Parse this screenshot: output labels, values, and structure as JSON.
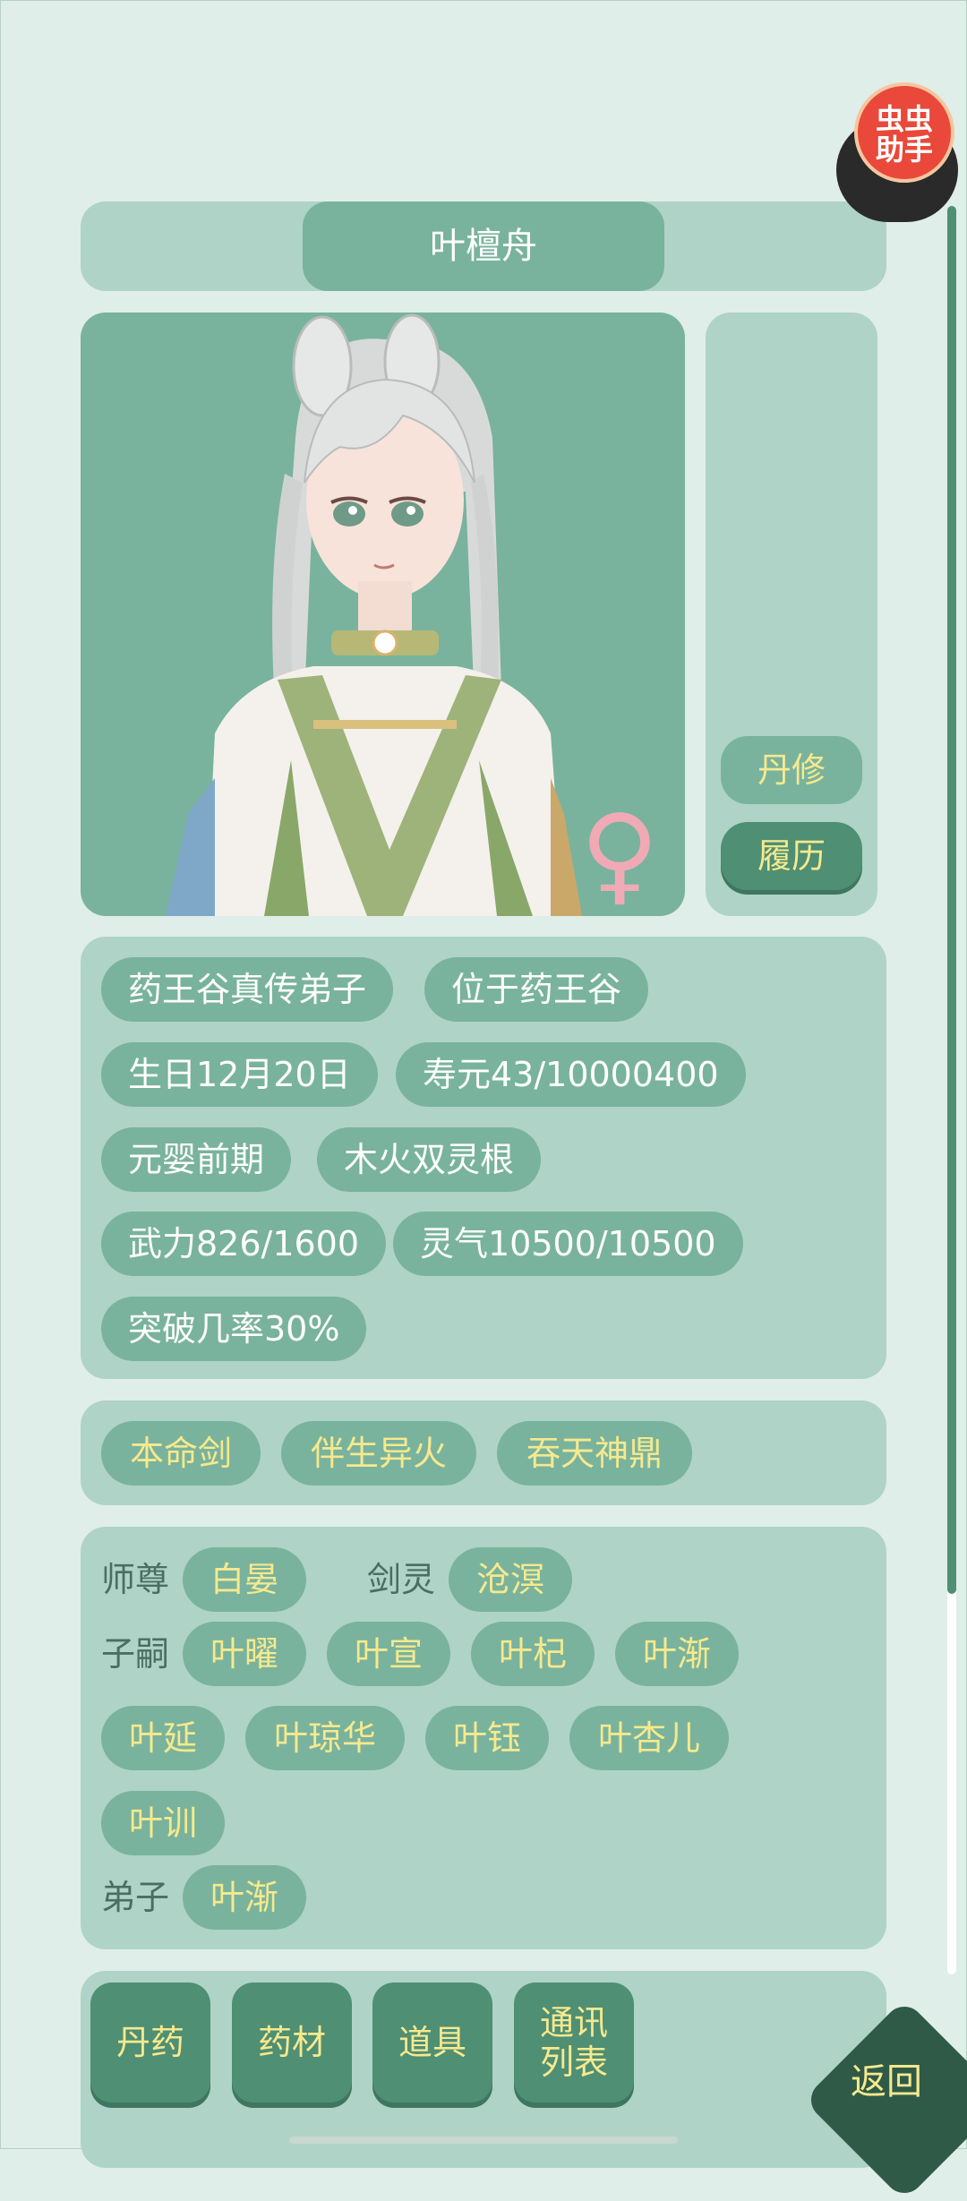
{
  "character": {
    "name": "叶檀舟",
    "gender_symbol": "♀"
  },
  "side_buttons": {
    "profession": "丹修",
    "history": "履历"
  },
  "info_chips": [
    "药王谷真传弟子",
    "位于药王谷",
    "生日12月20日",
    "寿元43/10000400",
    "元婴前期",
    "木火双灵根",
    "武力826/1600",
    "灵气10500/10500",
    "突破几率30%"
  ],
  "treasures": [
    "本命剑",
    "伴生异火",
    "吞天神鼎"
  ],
  "relations": {
    "master_label": "师尊",
    "master": "白晏",
    "sword_spirit_label": "剑灵",
    "sword_spirit": "沧溟",
    "children_label": "子嗣",
    "children": [
      "叶曜",
      "叶宣",
      "叶杞",
      "叶渐",
      "叶延",
      "叶琼华",
      "叶钰",
      "叶杏儿",
      "叶训"
    ],
    "disciples_label": "弟子",
    "disciples": [
      "叶渐"
    ]
  },
  "bottom_tabs": [
    "丹药",
    "药材",
    "道具",
    "通讯\n列表"
  ],
  "back_label": "返回",
  "overlay_badge": {
    "line1": "虫虫",
    "line2": "助手"
  },
  "colors": {
    "background": "#dfeee8",
    "panel": "#afd3c7",
    "chip": "#79b39d",
    "chip_text_accent": "#f6e98e",
    "button_dark": "#4f8f73",
    "back_button": "#2f5a47"
  }
}
